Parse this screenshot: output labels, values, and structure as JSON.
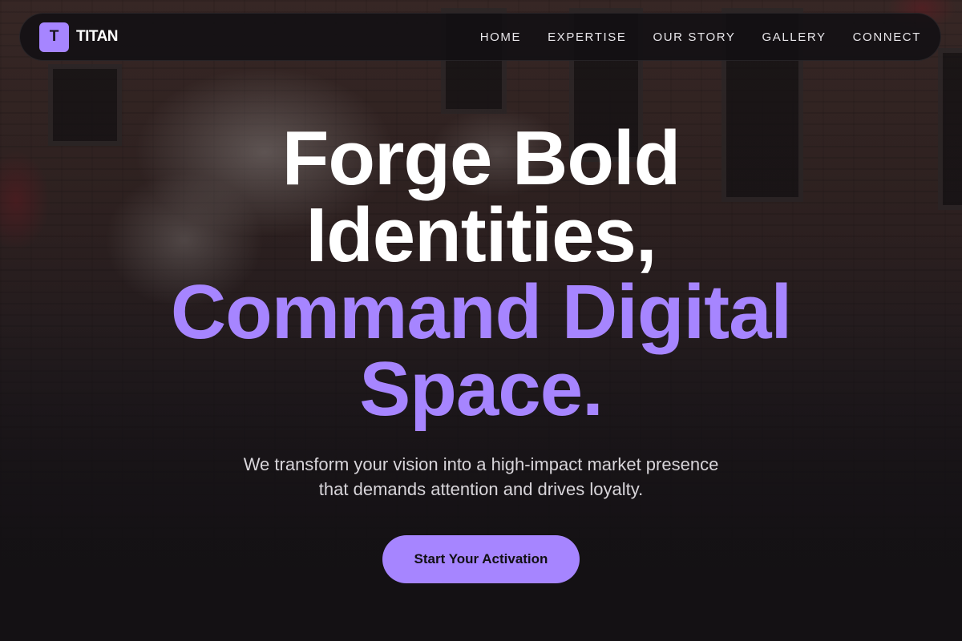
{
  "brand": {
    "logo_letter": "T",
    "name": "TITAN",
    "accent_color": "#a685ff"
  },
  "nav": {
    "links": [
      {
        "label": "HOME"
      },
      {
        "label": "EXPERTISE"
      },
      {
        "label": "OUR STORY"
      },
      {
        "label": "GALLERY"
      },
      {
        "label": "CONNECT"
      }
    ]
  },
  "hero": {
    "headline_lines": [
      {
        "text": "Forge Bold",
        "color": "#ffffff"
      },
      {
        "text": "Identities,",
        "color": "#ffffff"
      },
      {
        "text": "Command Digital",
        "color": "#a685ff"
      },
      {
        "text": "Space.",
        "color": "#a685ff"
      }
    ],
    "subtitle": "We transform your vision into a high-impact market presence that demands attention and drives loyalty.",
    "cta_label": "Start Your Activation"
  }
}
